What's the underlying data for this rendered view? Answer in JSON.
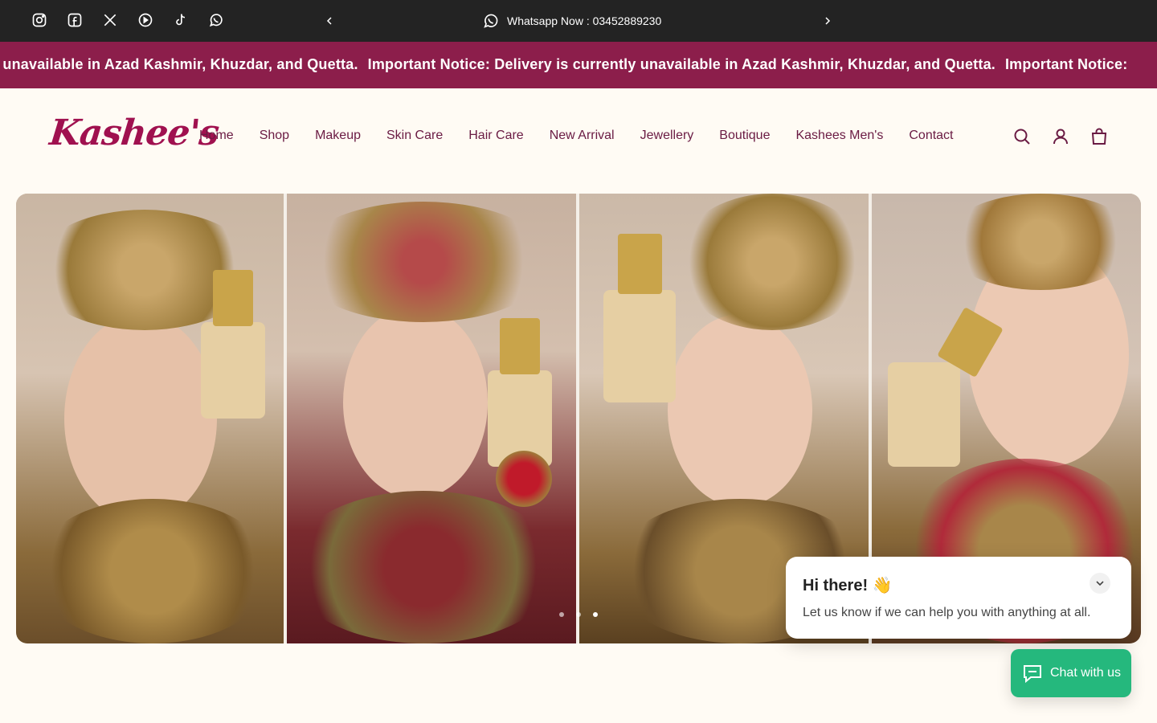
{
  "topbar": {
    "social_icons": [
      "instagram-icon",
      "facebook-icon",
      "x-icon",
      "youtube-icon",
      "tiktok-icon",
      "whatsapp-icon"
    ],
    "announcement": "Whatsapp Now : 03452889230",
    "background": "#232323"
  },
  "marquee": {
    "text_1": "y unavailable in Azad Kashmir, Khuzdar, and Quetta.",
    "text_2": "Important Notice: Delivery is currently unavailable in Azad Kashmir, Khuzdar, and Quetta.",
    "text_3": "Important Notice:",
    "background": "#8c1e4b"
  },
  "header": {
    "logo": "Kashee's",
    "nav": [
      "Home",
      "Shop",
      "Makeup",
      "Skin Care",
      "Hair Care",
      "New Arrival",
      "Jewellery",
      "Boutique",
      "Kashees Men's",
      "Contact"
    ],
    "icons": [
      "search-icon",
      "account-icon",
      "cart-icon"
    ],
    "accent": "#6a1b43"
  },
  "hero": {
    "slides_count": 3,
    "active_slide": 2
  },
  "chat": {
    "title": "Hi there! 👋",
    "subtitle": "Let us know if we can help you with anything at all.",
    "button_label": "Chat with us",
    "button_color": "#25b87d"
  }
}
